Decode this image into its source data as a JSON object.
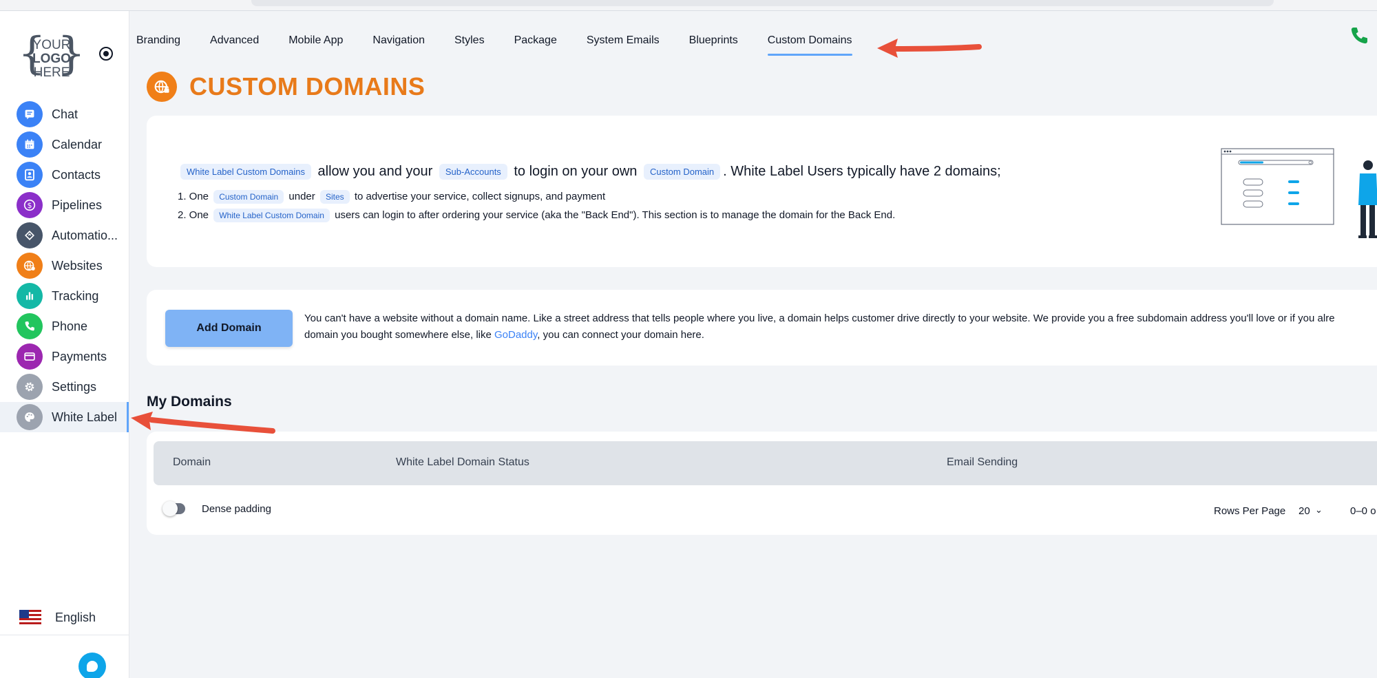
{
  "sidebar": {
    "logo": {
      "top": "YOUR",
      "middle": "LOGO",
      "bottom": "HERE"
    },
    "items": [
      {
        "label": "Chat",
        "icon": "chat-icon",
        "color": "#3b82f6",
        "key": "chat"
      },
      {
        "label": "Calendar",
        "icon": "calendar-icon",
        "color": "#3b82f6",
        "key": "calendar"
      },
      {
        "label": "Contacts",
        "icon": "contacts-icon",
        "color": "#3b82f6",
        "key": "contacts"
      },
      {
        "label": "Pipelines",
        "icon": "dollar-icon",
        "color": "#8b2fc9",
        "key": "pipelines"
      },
      {
        "label": "Automatio...",
        "icon": "automation-icon",
        "color": "#475569",
        "key": "automation"
      },
      {
        "label": "Websites",
        "icon": "globe-icon",
        "color": "#f07f18",
        "key": "websites"
      },
      {
        "label": "Tracking",
        "icon": "bar-chart-icon",
        "color": "#14b8a6",
        "key": "tracking"
      },
      {
        "label": "Phone",
        "icon": "phone-icon",
        "color": "#22c55e",
        "key": "phone"
      },
      {
        "label": "Payments",
        "icon": "card-icon",
        "color": "#9c27b0",
        "key": "payments"
      },
      {
        "label": "Settings",
        "icon": "gear-icon",
        "color": "#9ca3af",
        "key": "settings"
      },
      {
        "label": "White Label",
        "icon": "palette-icon",
        "color": "#9ca3af",
        "key": "white-label",
        "active": true
      }
    ],
    "language": "English"
  },
  "tabs": [
    {
      "label": "Branding"
    },
    {
      "label": "Advanced"
    },
    {
      "label": "Mobile App"
    },
    {
      "label": "Navigation"
    },
    {
      "label": "Styles"
    },
    {
      "label": "Package"
    },
    {
      "label": "System Emails"
    },
    {
      "label": "Blueprints"
    },
    {
      "label": "Custom Domains",
      "active": true
    }
  ],
  "header": {
    "title": "CUSTOM DOMAINS",
    "color": "#e87a1a"
  },
  "info": {
    "line1": {
      "chip_wlcd": "White Label Custom Domains",
      "text_a": "allow you and your",
      "chip_sub": "Sub-Accounts",
      "text_b": "to login on your own",
      "chip_cd": "Custom Domain",
      "text_c": ". White Label Users typically have 2 domains;"
    },
    "line2": {
      "prefix": "1. One",
      "chip_cd": "Custom Domain",
      "text_a": "under",
      "chip_sites": "Sites",
      "text_b": "to advertise your service, collect signups, and payment"
    },
    "line3": {
      "prefix": "2. One",
      "chip_wlcd": "White Label Custom Domain",
      "text_a": "users can login to after ordering your service (aka the \"Back End\"). This section is to manage the domain for the Back End."
    }
  },
  "add_domain": {
    "button_label": "Add Domain",
    "text_1": "You can't have a website without a domain name. Like a street address that tells people where you live, a domain helps customer drive directly to your website. We provide you a free subdomain address you'll love or if you alre",
    "text_2a": "domain you bought somewhere else, like",
    "link": "GoDaddy",
    "text_2b": ", you can connect your domain here."
  },
  "domains_table": {
    "title": "My Domains",
    "columns": [
      "Domain",
      "White Label Domain Status",
      "Email Sending"
    ],
    "rows": [],
    "dense_padding_label": "Dense padding",
    "rows_per_page_label": "Rows Per Page",
    "rows_per_page_value": "20",
    "range_text": "0–0 o"
  },
  "colors": {
    "accent_blue": "#60a5fa",
    "brand_orange": "#f07f18",
    "annotation_red": "#e8503a",
    "button_blue": "#7fb3f5"
  }
}
